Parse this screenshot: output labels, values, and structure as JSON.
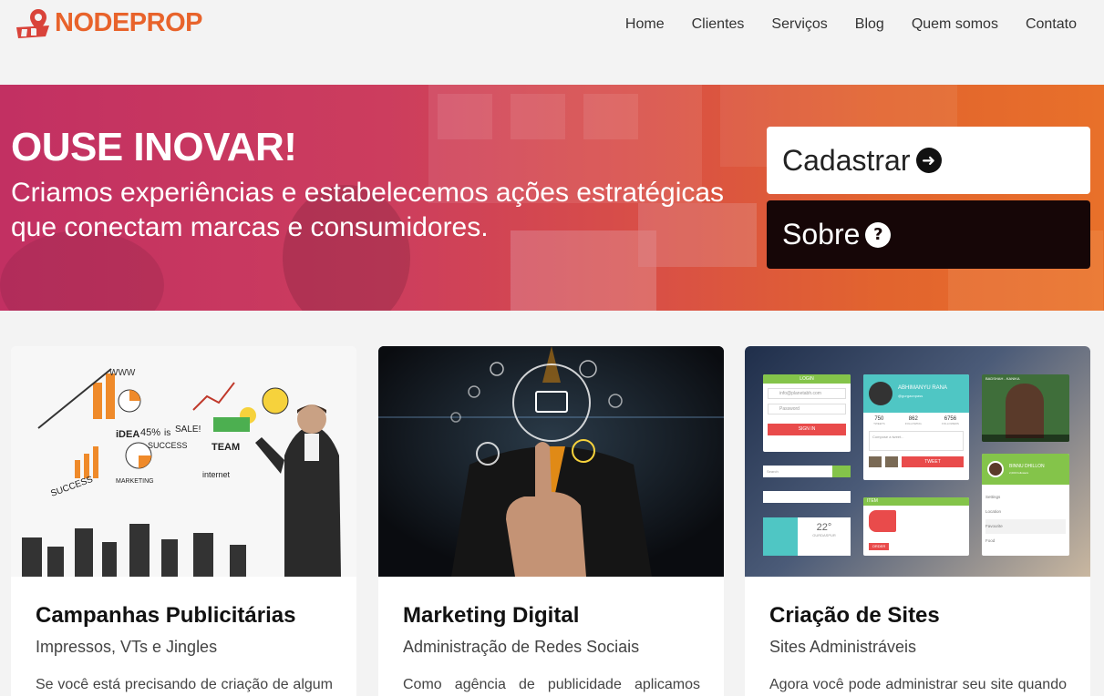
{
  "brand": {
    "name": "NODEPROP",
    "color": "#e8632b"
  },
  "nav": {
    "items": [
      "Home",
      "Clientes",
      "Serviços",
      "Blog",
      "Quem somos",
      "Contato"
    ]
  },
  "hero": {
    "title": "OUSE INOVAR!",
    "subtitle": "Criamos experiências e estabelecemos ações estratégicas que conectam marcas e consumidores.",
    "btn_register": "Cadastrar",
    "btn_about": "Sobre"
  },
  "cards": [
    {
      "title": "Campanhas Publicitárias",
      "subtitle": "Impressos, VTs e Jingles",
      "text": "Se você está precisando de criação de algum"
    },
    {
      "title": "Marketing Digital",
      "subtitle": "Administração de Redes Sociais",
      "text": "Como agência de publicidade aplicamos"
    },
    {
      "title": "Criação de Sites",
      "subtitle": "Sites Administráveis",
      "text": "Agora você pode administrar seu site quando e"
    }
  ],
  "card_images": {
    "img1": {
      "words": [
        "WWW",
        "iDEA",
        "45%",
        "is",
        "SALE!",
        "TEAM",
        "SUCCESS",
        "MARKETING",
        "25%",
        "internet"
      ]
    },
    "img3": {
      "login_title": "LOGIN",
      "email_placeholder": "info@planetabh.com",
      "password_placeholder": "Password",
      "sign_in": "SIGN IN",
      "profile_name": "ABHIMANYU RANA",
      "profile_handle": "@gurgaonpass",
      "stats": [
        {
          "value": "750",
          "label": "TWEETS"
        },
        {
          "value": "862",
          "label": "FOLLOWING"
        },
        {
          "value": "6756",
          "label": "FOLLOWERS"
        }
      ],
      "compose": "Compose a tweet...",
      "tweet_btn": "TWEET",
      "search": "Search",
      "item_label": "ITEM",
      "order": "ORDER",
      "weather_temp": "22°",
      "weather_city": "GURDASPUR",
      "user2_name": "BINNU DHILLON",
      "user2_followers": "2,000 Followers",
      "menu": [
        "Settings",
        "Location",
        "Favourite",
        "Food"
      ],
      "video_caption": "BADSHAH - KANIKA"
    }
  }
}
